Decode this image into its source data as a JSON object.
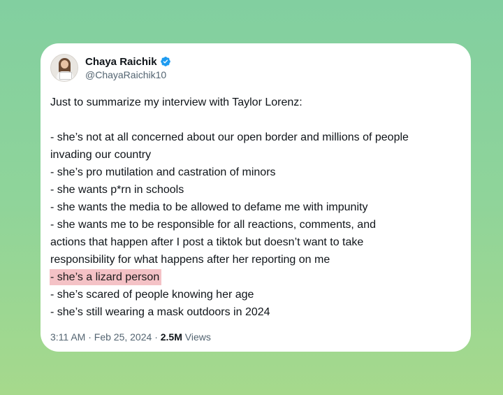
{
  "colors": {
    "background_top": "#82cfa0",
    "background_bottom": "#a6d98c",
    "card": "#ffffff",
    "highlight": "#f4c2c6",
    "verified_badge": "#1d9bf0",
    "secondary_text": "#536471"
  },
  "author": {
    "display_name": "Chaya Raichik",
    "handle": "@ChayaRaichik10",
    "verified_icon": "verified-badge-icon"
  },
  "tweet": {
    "intro": "Just to summarize my interview with Taylor Lorenz:",
    "lines": [
      "- she’s not at all concerned about our open border and millions of people",
      "invading our country",
      "- she’s pro mutilation and castration of minors",
      "- she wants p*rn in schools",
      "- she wants the media to be allowed to defame me with impunity",
      "- she wants me to be responsible for all reactions, comments, and",
      "actions that happen after I post a tiktok but doesn’t want to take",
      "responsibility for what happens after her reporting on me"
    ],
    "highlighted_line": "- she’s a lizard person",
    "after_lines": [
      "- she’s scared of people knowing her age",
      "- she’s still wearing a mask outdoors in 2024"
    ]
  },
  "meta": {
    "time": "3:11 AM",
    "separator": "·",
    "date": "Feb 25, 2024",
    "views_count": "2.5M",
    "views_label": "Views"
  }
}
